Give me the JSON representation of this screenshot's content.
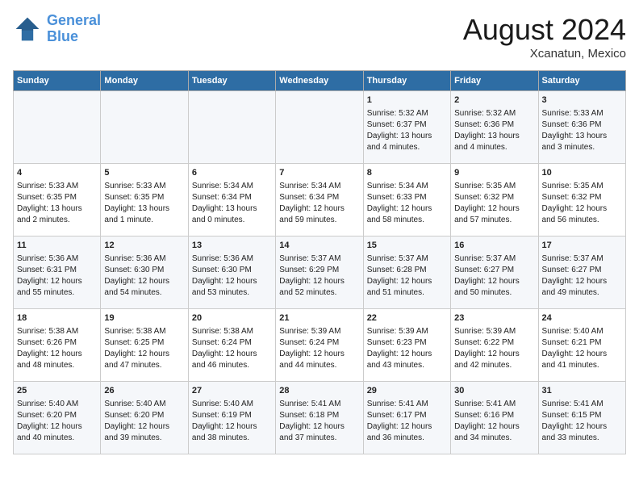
{
  "header": {
    "logo_line1": "General",
    "logo_line2": "Blue",
    "month_year": "August 2024",
    "location": "Xcanatun, Mexico"
  },
  "days_of_week": [
    "Sunday",
    "Monday",
    "Tuesday",
    "Wednesday",
    "Thursday",
    "Friday",
    "Saturday"
  ],
  "weeks": [
    [
      {
        "day": "",
        "content": ""
      },
      {
        "day": "",
        "content": ""
      },
      {
        "day": "",
        "content": ""
      },
      {
        "day": "",
        "content": ""
      },
      {
        "day": "1",
        "content": "Sunrise: 5:32 AM\nSunset: 6:37 PM\nDaylight: 13 hours\nand 4 minutes."
      },
      {
        "day": "2",
        "content": "Sunrise: 5:32 AM\nSunset: 6:36 PM\nDaylight: 13 hours\nand 4 minutes."
      },
      {
        "day": "3",
        "content": "Sunrise: 5:33 AM\nSunset: 6:36 PM\nDaylight: 13 hours\nand 3 minutes."
      }
    ],
    [
      {
        "day": "4",
        "content": "Sunrise: 5:33 AM\nSunset: 6:35 PM\nDaylight: 13 hours\nand 2 minutes."
      },
      {
        "day": "5",
        "content": "Sunrise: 5:33 AM\nSunset: 6:35 PM\nDaylight: 13 hours\nand 1 minute."
      },
      {
        "day": "6",
        "content": "Sunrise: 5:34 AM\nSunset: 6:34 PM\nDaylight: 13 hours\nand 0 minutes."
      },
      {
        "day": "7",
        "content": "Sunrise: 5:34 AM\nSunset: 6:34 PM\nDaylight: 12 hours\nand 59 minutes."
      },
      {
        "day": "8",
        "content": "Sunrise: 5:34 AM\nSunset: 6:33 PM\nDaylight: 12 hours\nand 58 minutes."
      },
      {
        "day": "9",
        "content": "Sunrise: 5:35 AM\nSunset: 6:32 PM\nDaylight: 12 hours\nand 57 minutes."
      },
      {
        "day": "10",
        "content": "Sunrise: 5:35 AM\nSunset: 6:32 PM\nDaylight: 12 hours\nand 56 minutes."
      }
    ],
    [
      {
        "day": "11",
        "content": "Sunrise: 5:36 AM\nSunset: 6:31 PM\nDaylight: 12 hours\nand 55 minutes."
      },
      {
        "day": "12",
        "content": "Sunrise: 5:36 AM\nSunset: 6:30 PM\nDaylight: 12 hours\nand 54 minutes."
      },
      {
        "day": "13",
        "content": "Sunrise: 5:36 AM\nSunset: 6:30 PM\nDaylight: 12 hours\nand 53 minutes."
      },
      {
        "day": "14",
        "content": "Sunrise: 5:37 AM\nSunset: 6:29 PM\nDaylight: 12 hours\nand 52 minutes."
      },
      {
        "day": "15",
        "content": "Sunrise: 5:37 AM\nSunset: 6:28 PM\nDaylight: 12 hours\nand 51 minutes."
      },
      {
        "day": "16",
        "content": "Sunrise: 5:37 AM\nSunset: 6:27 PM\nDaylight: 12 hours\nand 50 minutes."
      },
      {
        "day": "17",
        "content": "Sunrise: 5:37 AM\nSunset: 6:27 PM\nDaylight: 12 hours\nand 49 minutes."
      }
    ],
    [
      {
        "day": "18",
        "content": "Sunrise: 5:38 AM\nSunset: 6:26 PM\nDaylight: 12 hours\nand 48 minutes."
      },
      {
        "day": "19",
        "content": "Sunrise: 5:38 AM\nSunset: 6:25 PM\nDaylight: 12 hours\nand 47 minutes."
      },
      {
        "day": "20",
        "content": "Sunrise: 5:38 AM\nSunset: 6:24 PM\nDaylight: 12 hours\nand 46 minutes."
      },
      {
        "day": "21",
        "content": "Sunrise: 5:39 AM\nSunset: 6:24 PM\nDaylight: 12 hours\nand 44 minutes."
      },
      {
        "day": "22",
        "content": "Sunrise: 5:39 AM\nSunset: 6:23 PM\nDaylight: 12 hours\nand 43 minutes."
      },
      {
        "day": "23",
        "content": "Sunrise: 5:39 AM\nSunset: 6:22 PM\nDaylight: 12 hours\nand 42 minutes."
      },
      {
        "day": "24",
        "content": "Sunrise: 5:40 AM\nSunset: 6:21 PM\nDaylight: 12 hours\nand 41 minutes."
      }
    ],
    [
      {
        "day": "25",
        "content": "Sunrise: 5:40 AM\nSunset: 6:20 PM\nDaylight: 12 hours\nand 40 minutes."
      },
      {
        "day": "26",
        "content": "Sunrise: 5:40 AM\nSunset: 6:20 PM\nDaylight: 12 hours\nand 39 minutes."
      },
      {
        "day": "27",
        "content": "Sunrise: 5:40 AM\nSunset: 6:19 PM\nDaylight: 12 hours\nand 38 minutes."
      },
      {
        "day": "28",
        "content": "Sunrise: 5:41 AM\nSunset: 6:18 PM\nDaylight: 12 hours\nand 37 minutes."
      },
      {
        "day": "29",
        "content": "Sunrise: 5:41 AM\nSunset: 6:17 PM\nDaylight: 12 hours\nand 36 minutes."
      },
      {
        "day": "30",
        "content": "Sunrise: 5:41 AM\nSunset: 6:16 PM\nDaylight: 12 hours\nand 34 minutes."
      },
      {
        "day": "31",
        "content": "Sunrise: 5:41 AM\nSunset: 6:15 PM\nDaylight: 12 hours\nand 33 minutes."
      }
    ]
  ]
}
